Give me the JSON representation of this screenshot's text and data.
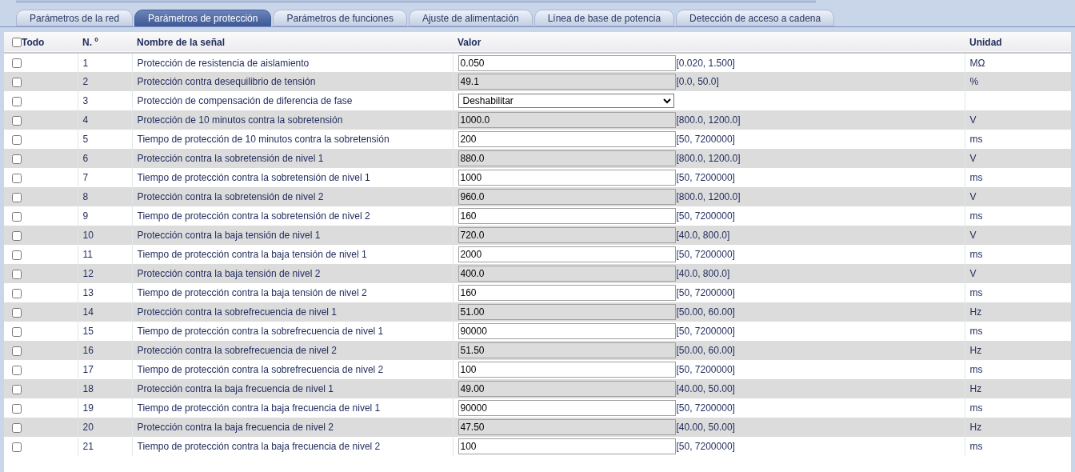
{
  "tabs": [
    {
      "label": "Parámetros de la red",
      "selected": false
    },
    {
      "label": "Parámetros de protección",
      "selected": true
    },
    {
      "label": "Parámetros de funciones",
      "selected": false
    },
    {
      "label": "Ajuste de alimentación",
      "selected": false
    },
    {
      "label": "Línea de base de potencia",
      "selected": false
    },
    {
      "label": "Detección de acceso a cadena",
      "selected": false
    }
  ],
  "table": {
    "columns": [
      "Todo",
      "N. º",
      "Nombre de la señal",
      "Valor",
      "Unidad"
    ],
    "all_checked": false,
    "rows": [
      {
        "checked": false,
        "no": "1",
        "name": "Protección de resistencia de aislamiento",
        "kind": "input",
        "value": "0.050",
        "range": "[0.020, 1.500]",
        "unit": "MΩ"
      },
      {
        "checked": false,
        "no": "2",
        "name": "Protección contra desequilibrio de tensión",
        "kind": "input",
        "value": "49.1",
        "range": "[0.0, 50.0]",
        "unit": "%"
      },
      {
        "checked": false,
        "no": "3",
        "name": "Protección de compensación de diferencia de fase",
        "kind": "select",
        "value": "Deshabilitar"
      },
      {
        "checked": false,
        "no": "4",
        "name": "Protección de 10 minutos contra la sobretensión",
        "kind": "input",
        "value": "1000.0",
        "range": "[800.0, 1200.0]",
        "unit": "V"
      },
      {
        "checked": false,
        "no": "5",
        "name": "Tiempo de protección de 10 minutos contra la sobretensión",
        "kind": "input",
        "value": "200",
        "range": "[50, 7200000]",
        "unit": "ms"
      },
      {
        "checked": false,
        "no": "6",
        "name": "Protección contra la sobretensión de nivel 1",
        "kind": "input",
        "value": "880.0",
        "range": "[800.0, 1200.0]",
        "unit": "V"
      },
      {
        "checked": false,
        "no": "7",
        "name": "Tiempo de protección contra la sobretensión de nivel 1",
        "kind": "input",
        "value": "1000",
        "range": "[50, 7200000]",
        "unit": "ms"
      },
      {
        "checked": false,
        "no": "8",
        "name": "Protección contra la sobretensión de nivel 2",
        "kind": "input",
        "value": "960.0",
        "range": "[800.0, 1200.0]",
        "unit": "V"
      },
      {
        "checked": false,
        "no": "9",
        "name": "Tiempo de protección contra la sobretensión de nivel 2",
        "kind": "input",
        "value": "160",
        "range": "[50, 7200000]",
        "unit": "ms"
      },
      {
        "checked": false,
        "no": "10",
        "name": "Protección contra la baja tensión de nivel 1",
        "kind": "input",
        "value": "720.0",
        "range": "[40.0, 800.0]",
        "unit": "V"
      },
      {
        "checked": false,
        "no": "11",
        "name": "Tiempo de protección contra la baja tensión de nivel 1",
        "kind": "input",
        "value": "2000",
        "range": "[50, 7200000]",
        "unit": "ms"
      },
      {
        "checked": false,
        "no": "12",
        "name": "Protección contra la baja tensión de nivel 2",
        "kind": "input",
        "value": "400.0",
        "range": "[40.0, 800.0]",
        "unit": "V"
      },
      {
        "checked": false,
        "no": "13",
        "name": "Tiempo de protección contra la baja tensión de nivel 2",
        "kind": "input",
        "value": "160",
        "range": "[50, 7200000]",
        "unit": "ms"
      },
      {
        "checked": false,
        "no": "14",
        "name": "Protección contra la sobrefrecuencia de nivel 1",
        "kind": "input",
        "value": "51.00",
        "range": "[50.00, 60.00]",
        "unit": "Hz"
      },
      {
        "checked": false,
        "no": "15",
        "name": "Tiempo de protección contra la sobrefrecuencia de nivel 1",
        "kind": "input",
        "value": "90000",
        "range": "[50, 7200000]",
        "unit": "ms"
      },
      {
        "checked": false,
        "no": "16",
        "name": "Protección contra la sobrefrecuencia de nivel 2",
        "kind": "input",
        "value": "51.50",
        "range": "[50.00, 60.00]",
        "unit": "Hz"
      },
      {
        "checked": false,
        "no": "17",
        "name": "Tiempo de protección contra la sobrefrecuencia de nivel 2",
        "kind": "input",
        "value": "100",
        "range": "[50, 7200000]",
        "unit": "ms"
      },
      {
        "checked": false,
        "no": "18",
        "name": "Protección contra la baja frecuencia de nivel 1",
        "kind": "input",
        "value": "49.00",
        "range": "[40.00, 50.00]",
        "unit": "Hz"
      },
      {
        "checked": false,
        "no": "19",
        "name": "Tiempo de protección contra la baja frecuencia de nivel 1",
        "kind": "input",
        "value": "90000",
        "range": "[50, 7200000]",
        "unit": "ms"
      },
      {
        "checked": false,
        "no": "20",
        "name": "Protección contra la baja frecuencia de nivel 2",
        "kind": "input",
        "value": "47.50",
        "range": "[40.00, 50.00]",
        "unit": "Hz"
      },
      {
        "checked": false,
        "no": "21",
        "name": "Tiempo de protección contra la baja frecuencia de nivel 2",
        "kind": "input",
        "value": "100",
        "range": "[50, 7200000]",
        "unit": "ms"
      }
    ]
  }
}
